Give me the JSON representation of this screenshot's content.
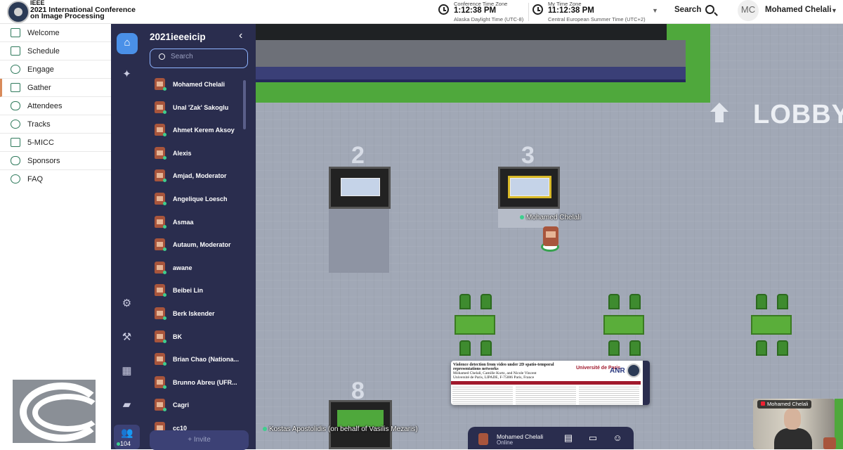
{
  "header": {
    "brand_line1": "IEEE",
    "brand_line2": "2021 International Conference",
    "brand_line3": "on Image Processing",
    "conference_tz": {
      "caption": "Conference Time Zone",
      "time": "1:12:38 PM",
      "zone": "Alaska Daylight Time (UTC-8)"
    },
    "my_tz": {
      "caption": "My Time Zone",
      "time": "11:12:38 PM",
      "zone": "Central European Summer Time (UTC+2)"
    },
    "search_label": "Search",
    "avatar_initials": "MC",
    "user_name": "Mohamed Chelali"
  },
  "nav": {
    "items": [
      {
        "label": "Welcome",
        "icon": "home-icon"
      },
      {
        "label": "Schedule",
        "icon": "calendar-icon"
      },
      {
        "label": "Engage",
        "icon": "chat-icon"
      },
      {
        "label": "Gather",
        "icon": "building-icon"
      },
      {
        "label": "Attendees",
        "icon": "people-icon"
      },
      {
        "label": "Tracks",
        "icon": "target-icon"
      },
      {
        "label": "5-MICC",
        "icon": "video-icon"
      },
      {
        "label": "Sponsors",
        "icon": "handshake-icon"
      },
      {
        "label": "FAQ",
        "icon": "help-icon"
      }
    ],
    "active": "Gather"
  },
  "panel": {
    "title": "2021ieeeicip",
    "search_placeholder": "Search",
    "people": [
      "Mohamed Chelali",
      "Unal 'Zak' Sakoglu",
      "Ahmet Kerem Aksoy",
      "Alexis",
      "Amjad, Moderator",
      "Angelique Loesch",
      "Asmaa",
      "Autaum, Moderator",
      "awane",
      "Beibei Lin",
      "Berk Iskender",
      "BK",
      "Brian Chao (Nationa...",
      "Brunno Abreu (UFR...",
      "Cagri",
      "cc10"
    ],
    "invite_label": "Invite",
    "online_count": "104"
  },
  "map": {
    "lobby_label": "LOBBY",
    "booth_numbers": [
      "2",
      "3",
      "8"
    ],
    "player_name": "Mohamed Chelali",
    "other_player": "Kostas Apostolidis (on behalf of Vasilis Mezaris)"
  },
  "poster": {
    "title": "Violence detection from video under 2D spatio-temporal representations networks",
    "authors": "Mohamed Chelali, Camille Kurtz, and Nicole Vincent",
    "affiliation": "Université de Paris, LIPADE, F-75006 Paris, France",
    "logo_text": "Université de Paris",
    "anr_text": "ANR"
  },
  "bottombar": {
    "name": "Mohamed Chelali",
    "status": "Online"
  },
  "video": {
    "label": "Mohamed Chelali"
  }
}
